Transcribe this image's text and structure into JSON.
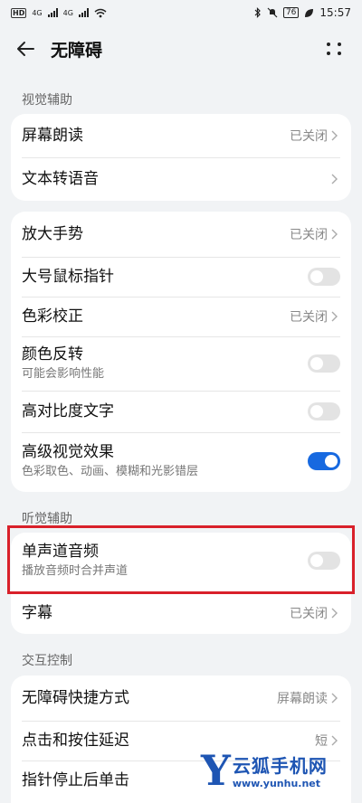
{
  "status_bar": {
    "hd_label": "HD",
    "net1": "4G",
    "net2": "4G",
    "battery": "76",
    "time": "15:57"
  },
  "app_bar": {
    "title": "无障碍",
    "back_icon": "arrow-left-icon",
    "more_icon": "more-dots-icon"
  },
  "sections": {
    "visual": "视觉辅助",
    "hearing": "听觉辅助",
    "interaction": "交互控制"
  },
  "card1": {
    "screen_reader": {
      "title": "屏幕朗读",
      "value": "已关闭"
    },
    "tts": {
      "title": "文本转语音"
    }
  },
  "card2": {
    "magnify": {
      "title": "放大手势",
      "value": "已关闭"
    },
    "large_pointer": {
      "title": "大号鼠标指针",
      "on": false
    },
    "color_correction": {
      "title": "色彩校正",
      "value": "已关闭"
    },
    "color_inversion": {
      "title": "颜色反转",
      "subtitle": "可能会影响性能",
      "on": false
    },
    "high_contrast": {
      "title": "高对比度文字",
      "on": false
    },
    "advanced_visual": {
      "title": "高级视觉效果",
      "subtitle": "色彩取色、动画、模糊和光影错层",
      "on": true
    }
  },
  "card3": {
    "mono_audio": {
      "title": "单声道音频",
      "subtitle": "播放音频时合并声道",
      "on": false
    },
    "captions": {
      "title": "字幕",
      "value": "已关闭"
    }
  },
  "card4": {
    "shortcut": {
      "title": "无障碍快捷方式",
      "value": "屏幕朗读"
    },
    "touch_delay": {
      "title": "点击和按住延迟",
      "value": "短"
    },
    "dwell_click": {
      "title": "指针停止后单击"
    }
  },
  "watermark": {
    "logo": "Y",
    "name": "云狐手机网",
    "url": "www.yunhu.net"
  },
  "colors": {
    "accent": "#1769e0",
    "highlight": "#d9202a",
    "background": "#f1f3f5"
  }
}
